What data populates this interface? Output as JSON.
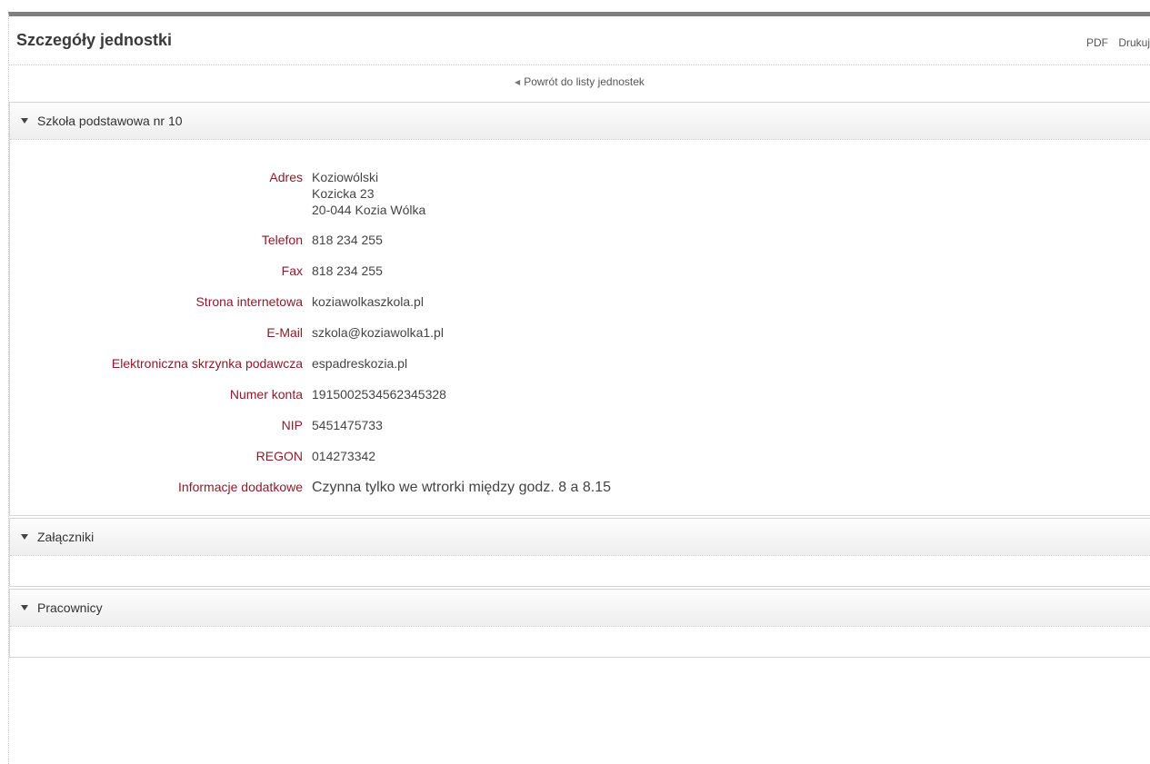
{
  "header": {
    "title": "Szczegóły jednostki",
    "pdf_label": "PDF",
    "print_label": "Drukuj"
  },
  "back_link": {
    "label": "Powrót do listy jednostek"
  },
  "unit": {
    "section_title": "Szkoła podstawowa nr 10",
    "fields": {
      "address_label": "Adres",
      "address_line1": "Koziowólski",
      "address_line2": "Kozicka 23",
      "address_line3": "20-044 Kozia Wólka",
      "phone_label": "Telefon",
      "phone": "818 234 255",
      "fax_label": "Fax",
      "fax": "818 234 255",
      "website_label": "Strona internetowa",
      "website": "koziawolkaszkola.pl",
      "email_label": "E-Mail",
      "email": "szkola@koziawolka1.pl",
      "epuap_label": "Elektroniczna skrzynka podawcza",
      "epuap": "espadreskozia.pl",
      "account_label": "Numer konta",
      "account": "1915002534562345328",
      "nip_label": "NIP",
      "nip": "5451475733",
      "regon_label": "REGON",
      "regon": "014273342",
      "info_label": "Informacje dodatkowe",
      "info": "Czynna tylko we wtrorki między godz. 8 a 8.15"
    }
  },
  "attachments": {
    "section_title": "Załączniki"
  },
  "employees": {
    "section_title": "Pracownicy"
  }
}
